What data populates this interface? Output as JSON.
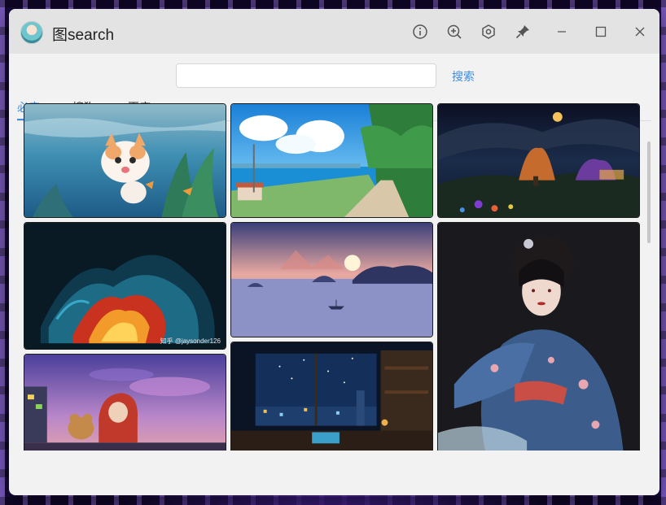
{
  "window": {
    "title": "图search"
  },
  "search": {
    "placeholder": "",
    "value": "",
    "button_label": "搜索"
  },
  "tabs": [
    {
      "label": "必应",
      "active": true
    },
    {
      "label": "搜狗",
      "active": false
    },
    {
      "label": "百度",
      "active": false
    }
  ],
  "toolbar_icons": [
    "info-icon",
    "zoom-in-icon",
    "settings-icon",
    "pin-icon",
    "minimize-icon",
    "maximize-icon",
    "close-icon"
  ],
  "gallery": {
    "images": [
      {
        "subject": "kitten-underwater"
      },
      {
        "subject": "anime-coastal-road"
      },
      {
        "subject": "night-village-starry-sky"
      },
      {
        "subject": "abstract-colorful-waves",
        "watermark": "知乎 @jaysonder126"
      },
      {
        "subject": "misty-lake-sunset"
      },
      {
        "subject": "hanfu-girl-dancing"
      },
      {
        "subject": "anime-kid-with-dog-sunset"
      },
      {
        "subject": "night-city-window-desk"
      }
    ]
  },
  "colors": {
    "accent": "#3c8ce7",
    "titlebar": "#e3e3e3",
    "window_bg": "#f2f2f2"
  }
}
